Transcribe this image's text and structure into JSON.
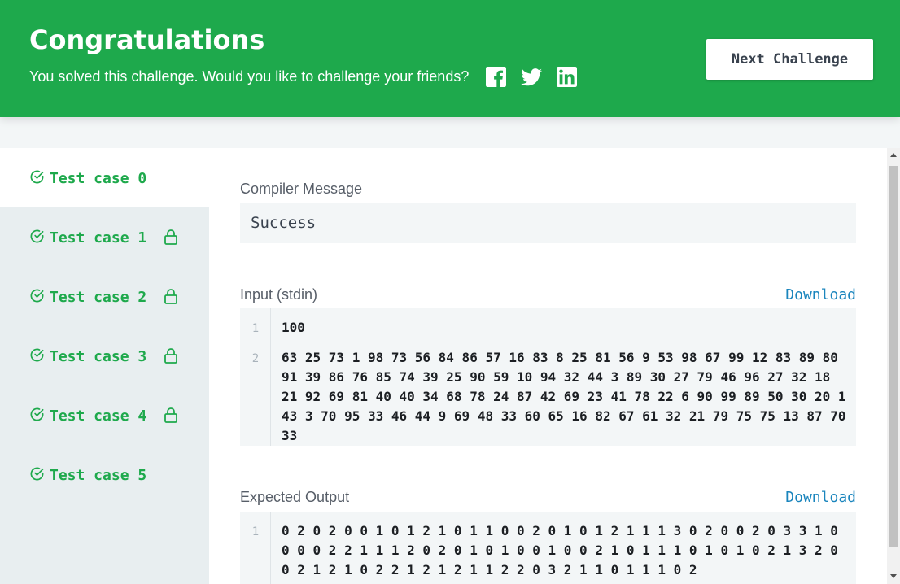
{
  "banner": {
    "title": "Congratulations",
    "subtitle": "You solved this challenge. Would you like to challenge your friends?",
    "social_icons": [
      "facebook-icon",
      "twitter-icon",
      "linkedin-icon"
    ],
    "next_label": "Next Challenge",
    "color": "#1ea94c"
  },
  "tabs": [
    {
      "label": "Test case 0",
      "locked": false,
      "active": true
    },
    {
      "label": "Test case 1",
      "locked": true,
      "active": false
    },
    {
      "label": "Test case 2",
      "locked": true,
      "active": false
    },
    {
      "label": "Test case 3",
      "locked": true,
      "active": false
    },
    {
      "label": "Test case 4",
      "locked": true,
      "active": false
    },
    {
      "label": "Test case 5",
      "locked": false,
      "active": false
    }
  ],
  "compiler": {
    "label": "Compiler Message",
    "message": "Success"
  },
  "input": {
    "label": "Input (stdin)",
    "download": "Download",
    "lines": [
      {
        "num": "1",
        "text": "100"
      },
      {
        "num": "2",
        "text": "63 25 73 1 98 73 56 84 86 57 16 83 8 25 81 56 9 53 98 67 99 12 83 89 80 91 39 86 76 85 74 39 25 90 59 10 94 32 44 3 89 30 27 79 46 96 27 32 18 21 92 69 81 40 40 34 68 78 24 87 42 69 23 41 78 22 6 90 99 89 50 30 20 1 43 3 70 95 33 46 44 9 69 48 33 60 65 16 82 67 61 32 21 79 75 75 13 87 70 33"
      }
    ]
  },
  "expected": {
    "label": "Expected Output",
    "download": "Download",
    "lines": [
      {
        "num": "1",
        "text": "0 2 0 2 0 0 1 0 1 2 1 0 1 1 0 0 2 0 1 0 1 2 1 1 1 3 0 2 0 0 2 0 3 3 1 0 0 0 0 2 2 1 1 1 2 0 2 0 1 0 1 0 0 1 0 0 2 1 0 1 1 1 0 1 0 1 0 2 1 3 2 0 0 2 1 2 1 0 2 2 1 2 1 2 1 1 2 2 0 3 2 1 1 0 1 1 1 0 2"
      }
    ]
  }
}
